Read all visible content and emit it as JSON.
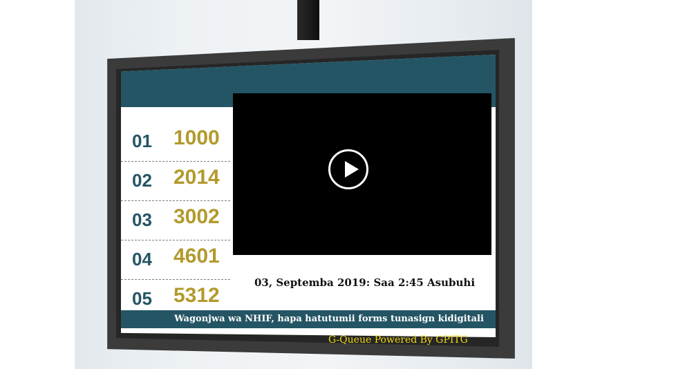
{
  "queue": {
    "rows": [
      {
        "counter": "01",
        "ticket": "1000"
      },
      {
        "counter": "02",
        "ticket": "2014"
      },
      {
        "counter": "03",
        "ticket": "3002"
      },
      {
        "counter": "04",
        "ticket": "4601"
      },
      {
        "counter": "05",
        "ticket": "5312"
      }
    ]
  },
  "video": {
    "play_icon": "play-icon"
  },
  "datetime": "03, Septemba 2019: Saa 2:45 Asubuhi",
  "ticker": "Wagonjwa wa NHIF, hapa hatutumii forms tunasign kidigitali",
  "footer": "G-Queue Powered By GPITG",
  "colors": {
    "band": "#245564",
    "ticket": "#b29a2c",
    "footer": "#f2d90f"
  }
}
